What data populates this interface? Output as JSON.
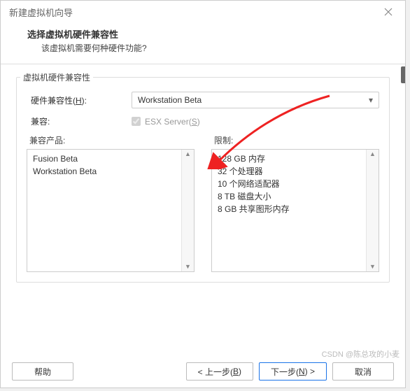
{
  "window": {
    "title": "新建虚拟机向导"
  },
  "header": {
    "title": "选择虚拟机硬件兼容性",
    "subtitle": "该虚拟机需要何种硬件功能?"
  },
  "group": {
    "label": "虚拟机硬件兼容性",
    "hw_label": "硬件兼容性(",
    "hw_key": "H",
    "hw_label_end": "):",
    "hw_value": "Workstation Beta",
    "compat_label": "兼容:",
    "esx_label": "ESX Server(",
    "esx_key": "S",
    "esx_label_end": ")"
  },
  "lists": {
    "products_label": "兼容产品:",
    "limits_label": "限制:",
    "products": [
      "Fusion Beta",
      "Workstation Beta"
    ],
    "limits": [
      "128 GB 内存",
      "32 个处理器",
      "10 个网络适配器",
      "8 TB 磁盘大小",
      "8 GB 共享图形内存"
    ]
  },
  "buttons": {
    "help": "帮助",
    "back": "< 上一步(",
    "back_key": "B",
    "back_end": ")",
    "next": "下一步(",
    "next_key": "N",
    "next_end": ") >",
    "cancel": "取消"
  },
  "watermark": "CSDN @陈总攻的小麦"
}
